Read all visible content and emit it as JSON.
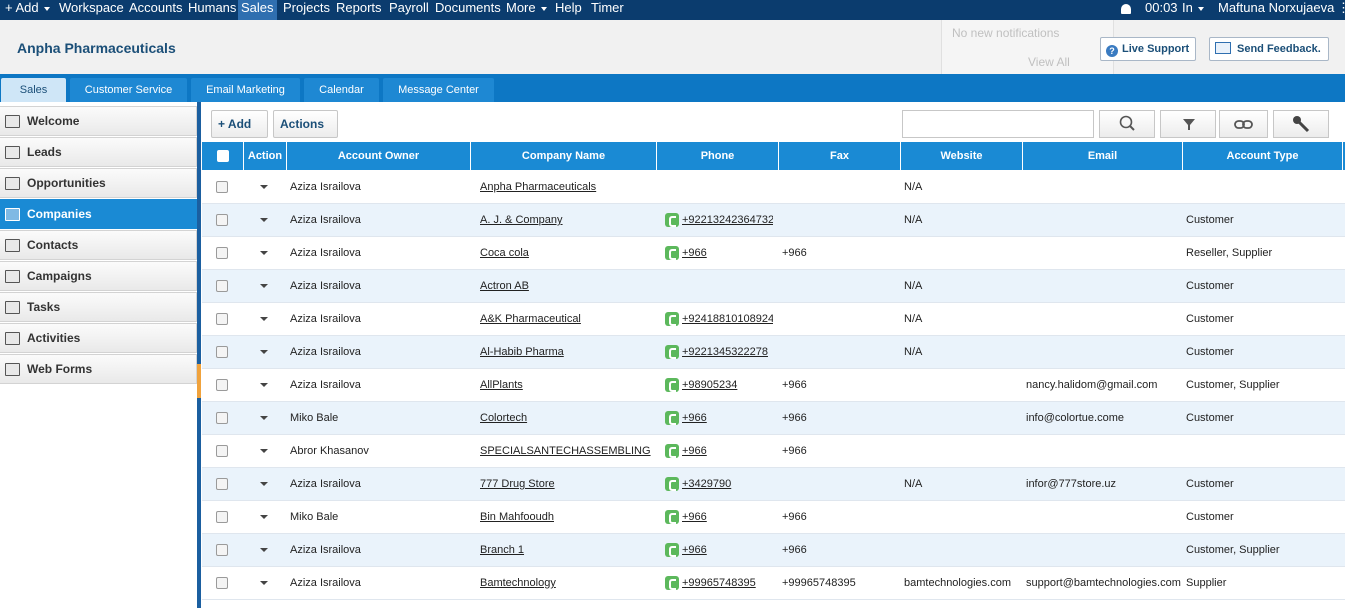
{
  "topnav": {
    "items": [
      "+ Add",
      "Workspace",
      "Accounts",
      "Humans",
      "Sales",
      "Projects",
      "Reports",
      "Payroll",
      "Documents",
      "More",
      "Help",
      "Timer"
    ],
    "time": "00:03",
    "status": "In",
    "user": "Maftuna Norxujaeva"
  },
  "header": {
    "company": "Anpha Pharmaceuticals",
    "notifications": {
      "empty_text": "No new notifications",
      "view_all": "View All"
    },
    "live_support": "Live Support",
    "send_feedback": "Send Feedback."
  },
  "module_tabs": [
    "Sales",
    "Customer Service",
    "Email Marketing",
    "Calendar",
    "Message Center"
  ],
  "sidebar": {
    "items": [
      {
        "label": "Welcome",
        "icon": "welcome-icon"
      },
      {
        "label": "Leads",
        "icon": "leads-icon"
      },
      {
        "label": "Opportunities",
        "icon": "opportunities-icon"
      },
      {
        "label": "Companies",
        "icon": "companies-icon"
      },
      {
        "label": "Contacts",
        "icon": "contacts-icon"
      },
      {
        "label": "Campaigns",
        "icon": "campaigns-icon"
      },
      {
        "label": "Tasks",
        "icon": "tasks-icon"
      },
      {
        "label": "Activities",
        "icon": "activities-icon"
      },
      {
        "label": "Web Forms",
        "icon": "web-forms-icon"
      }
    ],
    "active": "Companies"
  },
  "toolbar": {
    "add_label": "+ Add",
    "actions_label": "Actions",
    "search_value": ""
  },
  "table": {
    "columns": [
      "Action",
      "Account Owner",
      "Company Name",
      "Phone",
      "Fax",
      "Website",
      "Email",
      "Account Type"
    ],
    "rows": [
      {
        "owner": "Aziza Israilova",
        "company": "Anpha Pharmaceuticals",
        "phone": "",
        "fax": "",
        "website": "N/A",
        "email": "",
        "type": ""
      },
      {
        "owner": "Aziza Israilova",
        "company": "A. J. & Company",
        "phone": "+92213242364732",
        "fax": "",
        "website": "N/A",
        "email": "",
        "type": "Customer"
      },
      {
        "owner": "Aziza Israilova",
        "company": "Coca cola",
        "phone": "+966",
        "fax": "+966",
        "website": "",
        "email": "",
        "type": "Reseller, Supplier"
      },
      {
        "owner": "Aziza Israilova",
        "company": "Actron AB",
        "phone": "",
        "fax": "",
        "website": "N/A",
        "email": "",
        "type": "Customer"
      },
      {
        "owner": "Aziza Israilova",
        "company": "A&K Pharmaceutical",
        "phone": "+92418810108924",
        "fax": "",
        "website": "N/A",
        "email": "",
        "type": "Customer"
      },
      {
        "owner": "Aziza Israilova",
        "company": "Al-Habib Pharma",
        "phone": "+9221345322278",
        "fax": "",
        "website": "N/A",
        "email": "",
        "type": "Customer"
      },
      {
        "owner": "Aziza Israilova",
        "company": "AllPlants",
        "phone": "+98905234",
        "fax": "+966",
        "website": "",
        "email": "nancy.halidom@gmail.com",
        "type": "Customer, Supplier"
      },
      {
        "owner": "Miko Bale",
        "company": "Colortech",
        "phone": "+966",
        "fax": "+966",
        "website": "",
        "email": "info@colortue.come",
        "type": "Customer"
      },
      {
        "owner": "Abror Khasanov",
        "company": "SPECIALSANTECHASSEMBLING",
        "phone": "+966",
        "fax": "+966",
        "website": "",
        "email": "",
        "type": ""
      },
      {
        "owner": "Aziza Israilova",
        "company": "777 Drug Store",
        "phone": "+3429790",
        "fax": "",
        "website": "N/A",
        "email": "infor@777store.uz",
        "type": "Customer"
      },
      {
        "owner": "Miko Bale",
        "company": "Bin Mahfooudh",
        "phone": "+966",
        "fax": "+966",
        "website": "",
        "email": "",
        "type": "Customer"
      },
      {
        "owner": "Aziza Israilova",
        "company": "Branch 1",
        "phone": "+966",
        "fax": "+966",
        "website": "",
        "email": "",
        "type": "Customer, Supplier"
      },
      {
        "owner": "Aziza Israilova",
        "company": "Bamtechnology",
        "phone": "+99965748395",
        "fax": "+99965748395",
        "website": "bamtechnologies.com",
        "email": "support@bamtechnologies.com",
        "type": "Supplier"
      }
    ]
  },
  "colors": {
    "topnav": "#0b3c6e",
    "accent": "#1a8ad4",
    "row_alt": "#eaf3fb",
    "phone_icon": "#5cb85c"
  }
}
